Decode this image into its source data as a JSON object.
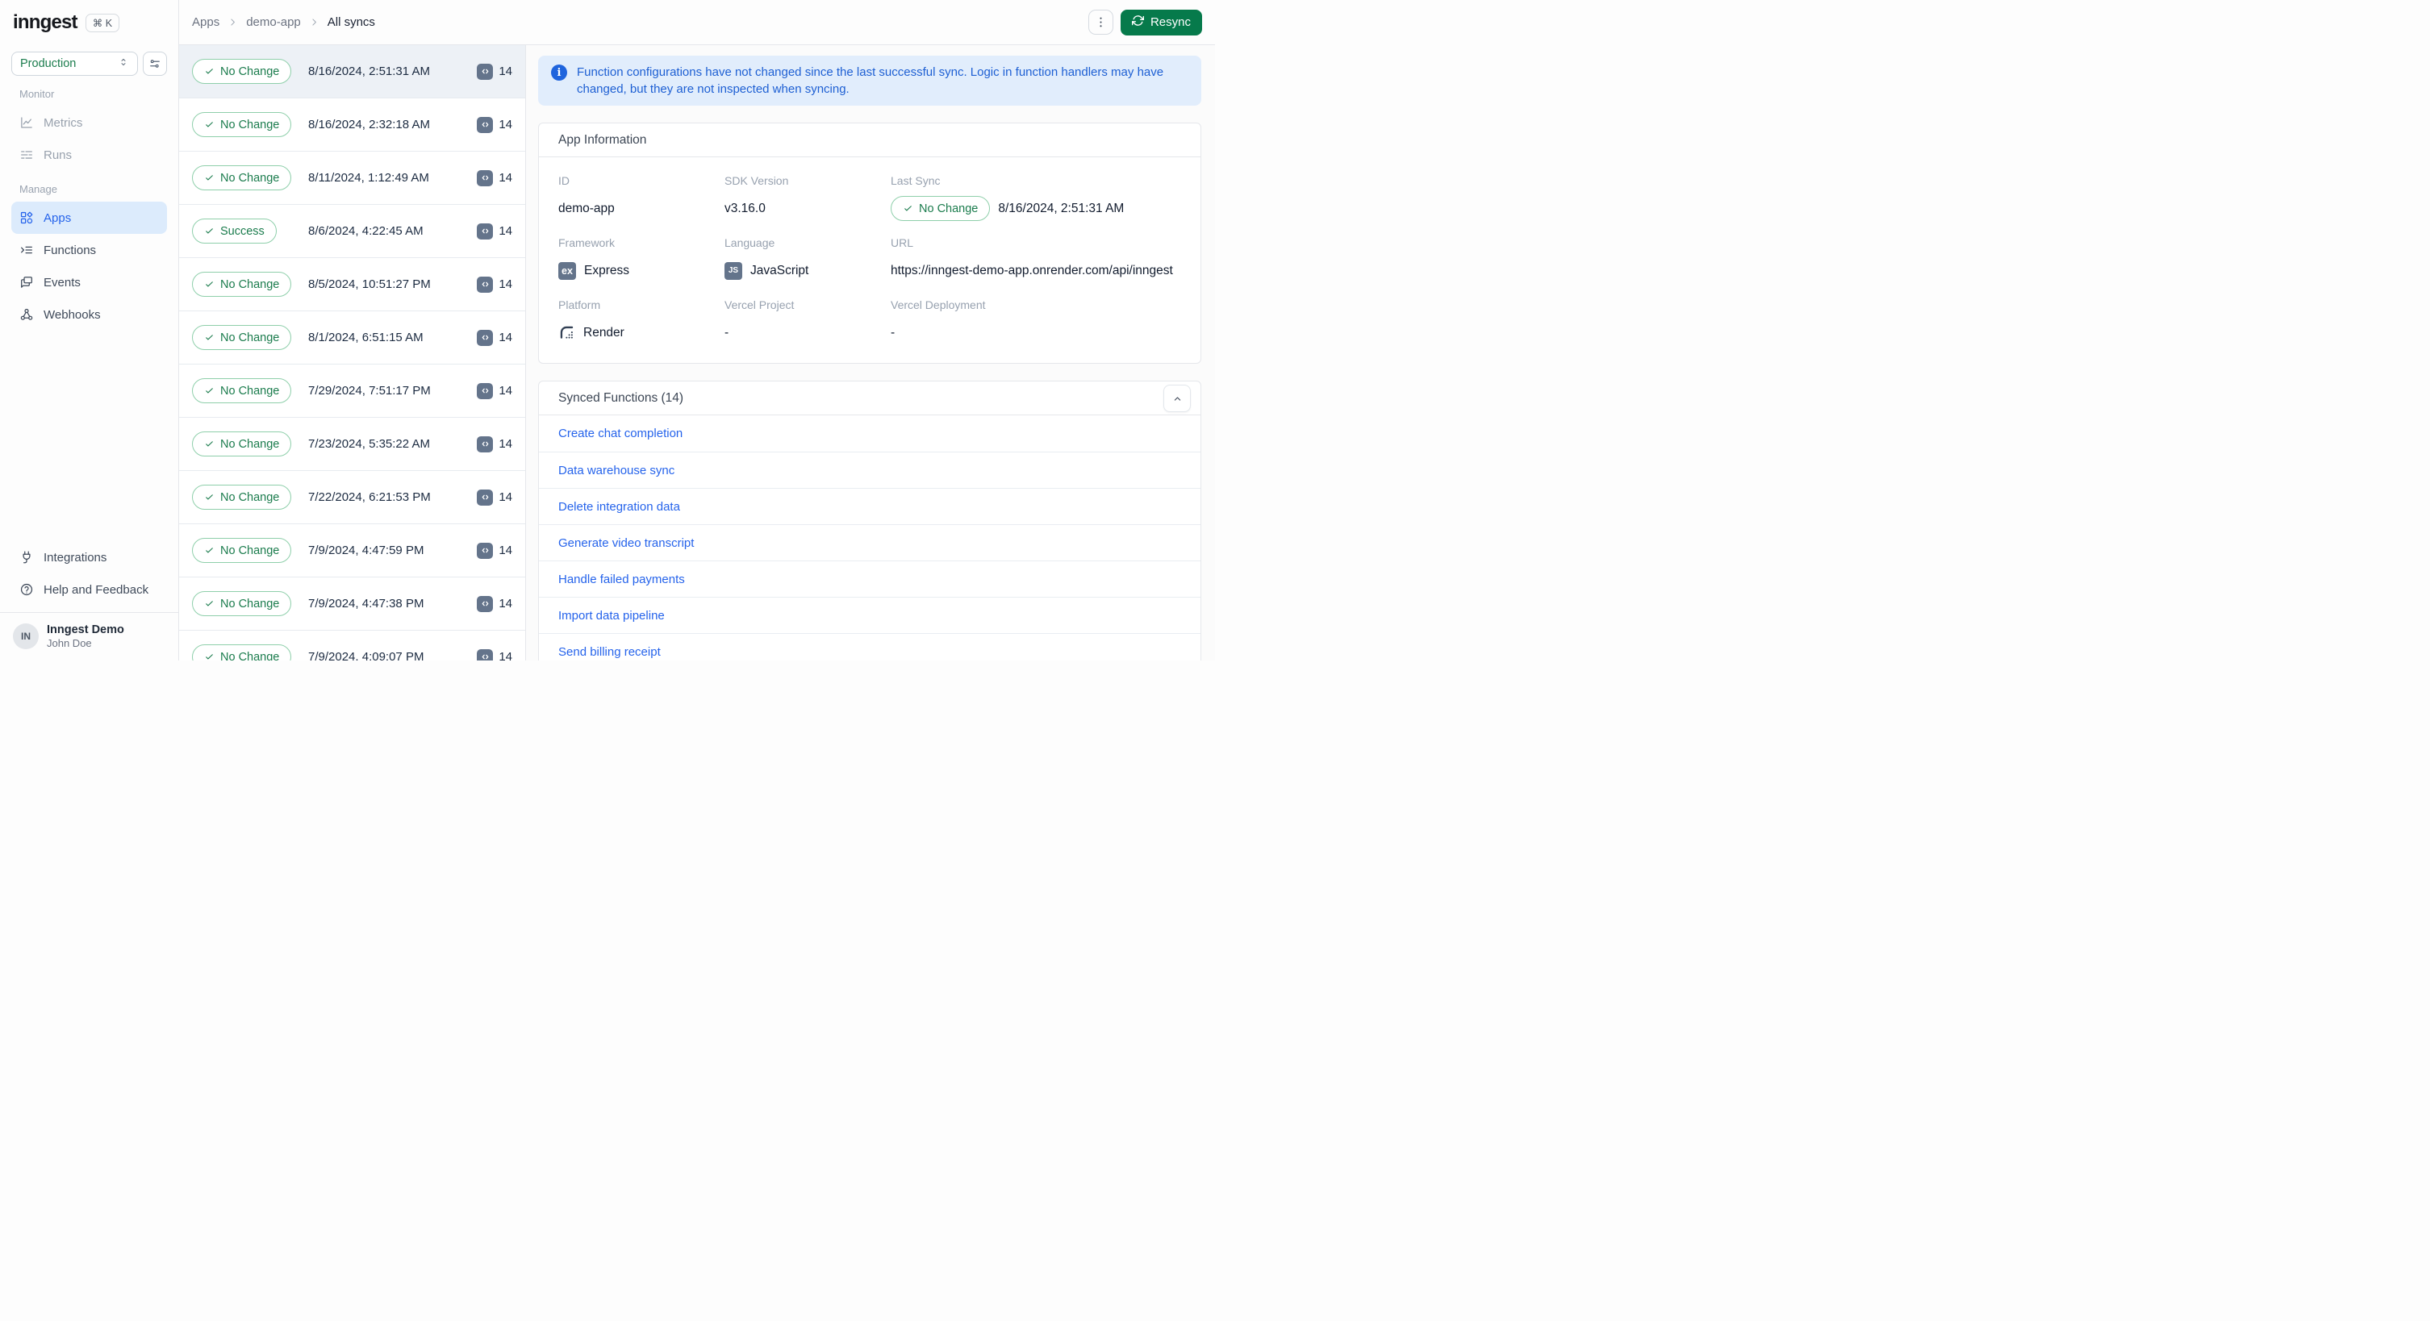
{
  "colors": {
    "accent_green": "#067a4b",
    "badge_green_text": "#1b7c4d",
    "badge_green_border": "#8ecfaa",
    "link_blue": "#2563eb",
    "active_item_blue": "#2563eb",
    "active_item_bg": "#dcebfc",
    "banner_bg": "#e1edfc",
    "banner_text": "#1d5fd3",
    "banner_icon_bg": "#1f64dd",
    "chip_slate": "#64748b",
    "dark_text": "#1c2b41",
    "selected_row_bg": "#edf1f6"
  },
  "sidebar": {
    "logo_text": "inngest",
    "shortcut": "⌘ K",
    "environment": "Production",
    "sections": [
      {
        "label": "Monitor",
        "items": [
          {
            "label": "Metrics",
            "icon": "chart-line",
            "muted": true
          },
          {
            "label": "Runs",
            "icon": "list-runs",
            "muted": true
          }
        ]
      },
      {
        "label": "Manage",
        "items": [
          {
            "label": "Apps",
            "icon": "apps",
            "active": true
          },
          {
            "label": "Functions",
            "icon": "functions"
          },
          {
            "label": "Events",
            "icon": "events"
          },
          {
            "label": "Webhooks",
            "icon": "webhook"
          }
        ]
      }
    ],
    "footer_items": [
      {
        "label": "Integrations",
        "icon": "plug"
      },
      {
        "label": "Help and Feedback",
        "icon": "help-circle"
      }
    ],
    "account": {
      "initials": "IN",
      "org": "Inngest Demo",
      "user": "John Doe"
    }
  },
  "header": {
    "breadcrumb": [
      "Apps",
      "demo-app",
      "All syncs"
    ],
    "resync_label": "Resync"
  },
  "sync_list": [
    {
      "status": "No Change",
      "timestamp": "8/16/2024, 2:51:31 AM",
      "count": "14",
      "selected": true
    },
    {
      "status": "No Change",
      "timestamp": "8/16/2024, 2:32:18 AM",
      "count": "14"
    },
    {
      "status": "No Change",
      "timestamp": "8/11/2024, 1:12:49 AM",
      "count": "14"
    },
    {
      "status": "Success",
      "timestamp": "8/6/2024, 4:22:45 AM",
      "count": "14"
    },
    {
      "status": "No Change",
      "timestamp": "8/5/2024, 10:51:27 PM",
      "count": "14"
    },
    {
      "status": "No Change",
      "timestamp": "8/1/2024, 6:51:15 AM",
      "count": "14"
    },
    {
      "status": "No Change",
      "timestamp": "7/29/2024, 7:51:17 PM",
      "count": "14"
    },
    {
      "status": "No Change",
      "timestamp": "7/23/2024, 5:35:22 AM",
      "count": "14"
    },
    {
      "status": "No Change",
      "timestamp": "7/22/2024, 6:21:53 PM",
      "count": "14"
    },
    {
      "status": "No Change",
      "timestamp": "7/9/2024, 4:47:59 PM",
      "count": "14"
    },
    {
      "status": "No Change",
      "timestamp": "7/9/2024, 4:47:38 PM",
      "count": "14"
    },
    {
      "status": "No Change",
      "timestamp": "7/9/2024, 4:09:07 PM",
      "count": "14"
    }
  ],
  "banner": {
    "text": "Function configurations have not changed since the last successful sync. Logic in function handlers may have changed, but they are not inspected when syncing."
  },
  "app_info": {
    "title": "App Information",
    "fields": [
      {
        "label": "ID",
        "value": "demo-app"
      },
      {
        "label": "SDK Version",
        "value": "v3.16.0"
      },
      {
        "label": "Last Sync",
        "badge": "No Change",
        "value": "8/16/2024, 2:51:31 AM"
      },
      {
        "label": "Framework",
        "icon": "express",
        "icon_text": "ex",
        "value": "Express"
      },
      {
        "label": "Language",
        "icon": "javascript",
        "icon_text": "JS",
        "value": "JavaScript"
      },
      {
        "label": "URL",
        "value": "https://inngest-demo-app.onrender.com/api/inngest",
        "nowrap": true
      },
      {
        "label": "Platform",
        "icon": "render",
        "value": "Render"
      },
      {
        "label": "Vercel Project",
        "value": "-"
      },
      {
        "label": "Vercel Deployment",
        "value": "-"
      }
    ]
  },
  "synced_functions": {
    "title": "Synced Functions (14)",
    "items": [
      "Create chat completion",
      "Data warehouse sync",
      "Delete integration data",
      "Generate video transcript",
      "Handle failed payments",
      "Import data pipeline",
      "Send billing receipt"
    ]
  }
}
